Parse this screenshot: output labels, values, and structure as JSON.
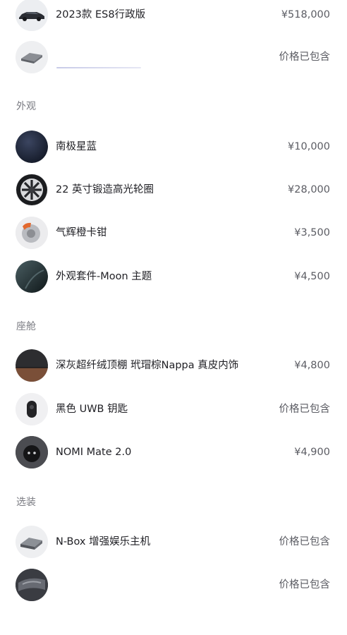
{
  "vehicle": {
    "name": "2023款 ES8行政版",
    "price": "¥518,000",
    "thumb_icon": "car-photo"
  },
  "included_item": {
    "name": "",
    "price": "价格已包含",
    "thumb_icon": "battery-pack-photo"
  },
  "sections": {
    "exterior": {
      "title": "外观",
      "items": [
        {
          "name": "南极星蓝",
          "price": "¥10,000",
          "icon": "paint-swatch-icon"
        },
        {
          "name": "22 英寸锻造高光轮圈",
          "price": "¥28,000",
          "icon": "wheel-icon"
        },
        {
          "name": "气辉橙卡钳",
          "price": "¥3,500",
          "icon": "brake-caliper-icon"
        },
        {
          "name": "外观套件-Moon 主题",
          "price": "¥4,500",
          "icon": "exterior-kit-icon"
        }
      ]
    },
    "cabin": {
      "title": "座舱",
      "items": [
        {
          "name": "深灰超纤绒顶棚 玳瑁棕Nappa 真皮内饰",
          "price": "¥4,800",
          "icon": "interior-swatch-icon"
        },
        {
          "name": "黑色 UWB 钥匙",
          "price": "价格已包含",
          "icon": "key-fob-icon"
        },
        {
          "name": "NOMI Mate 2.0",
          "price": "¥4,900",
          "icon": "nomi-icon"
        }
      ]
    },
    "options": {
      "title": "选装",
      "items": [
        {
          "name": "N-Box 增强娱乐主机",
          "price": "价格已包含",
          "icon": "n-box-icon"
        },
        {
          "name": "",
          "price": "价格已包含",
          "icon": "accessory-icon"
        }
      ]
    }
  },
  "colors": {
    "paint": "#1e2435",
    "caliper": "#e2692f",
    "section_text": "#7a7b82",
    "price_text": "#5b5c63"
  }
}
